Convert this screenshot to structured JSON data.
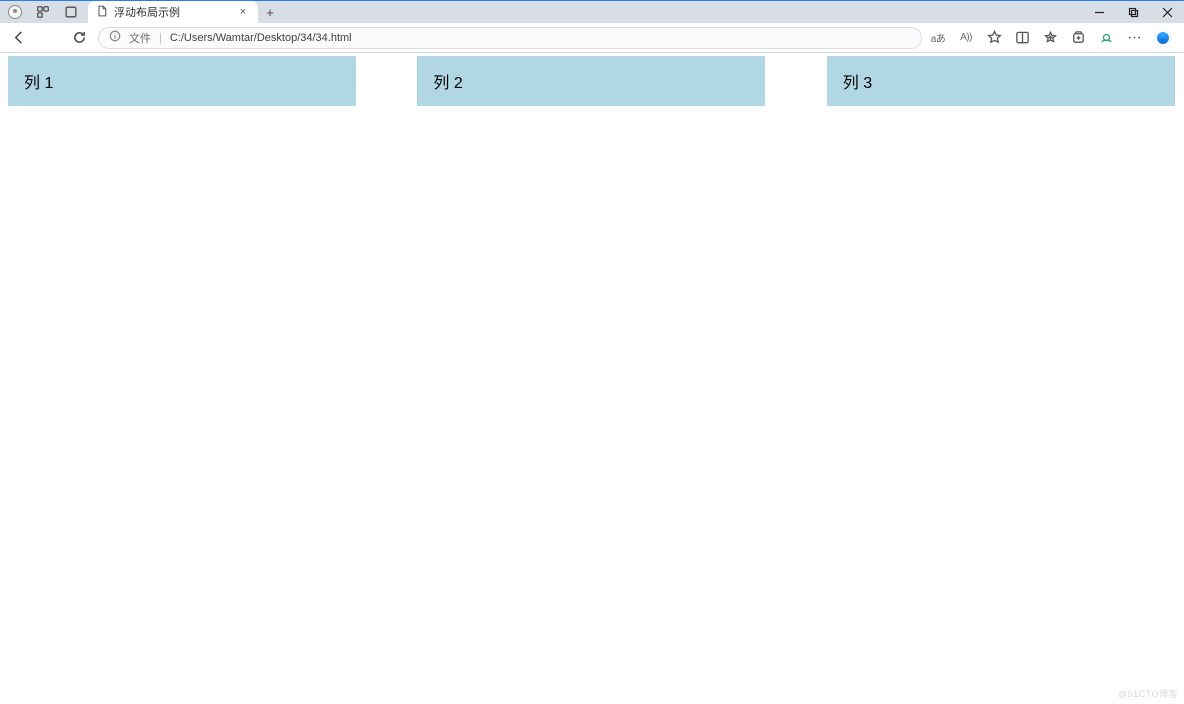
{
  "tab": {
    "title": "浮动布局示例"
  },
  "address": {
    "label": "文件",
    "path": "C:/Users/Wamtar/Desktop/34/34.html"
  },
  "toolbar_icons": {
    "translate": "aあ",
    "read_aloud": "A))"
  },
  "columns": [
    {
      "label": "列 1"
    },
    {
      "label": "列 2"
    },
    {
      "label": "列 3"
    }
  ],
  "watermark": "@51CTO博客"
}
